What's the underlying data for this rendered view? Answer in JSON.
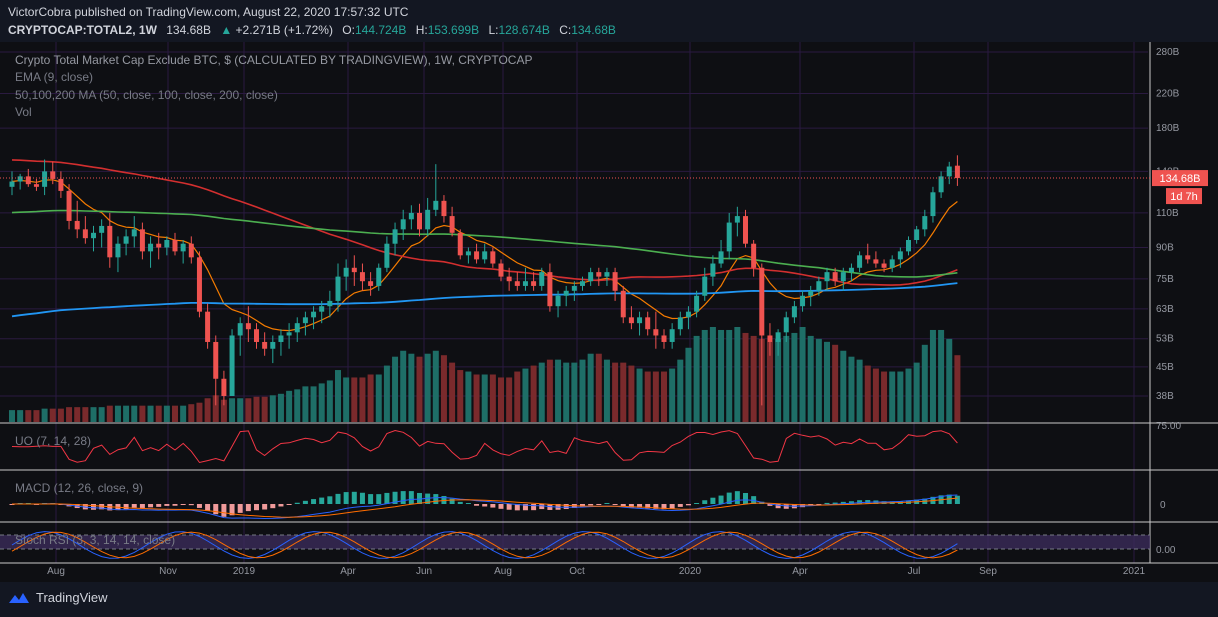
{
  "header": {
    "publisher": "VictorCobra published on TradingView.com, August 22, 2020 17:57:32 UTC",
    "symbol": "CRYPTOCAP:TOTAL2, 1W",
    "last": "134.68B",
    "change": "+2.271B (+1.72%)",
    "o_label": "O:",
    "o_value": "144.724B",
    "h_label": "H:",
    "h_value": "153.699B",
    "l_label": "L:",
    "l_value": "128.674B",
    "c_label": "C:",
    "c_value": "134.68B"
  },
  "legend": {
    "main": "Crypto Total Market Cap Exclude BTC, $ (CALCULATED BY TRADINGVIEW), 1W, CRYPTOCAP",
    "ema": "EMA (9, close)",
    "ma": "50,100,200 MA (50, close, 100, close, 200, close)",
    "vol": "Vol",
    "uo": "UO (7, 14, 28)",
    "macd": "MACD (12, 26, close, 9)",
    "stoch": "Stoch RSI (3, 3, 14, 14, close)"
  },
  "price_badge": "134.68B",
  "time_badge": "1d 7h",
  "footer": {
    "brand": "TradingView"
  },
  "colors": {
    "background": "#0e0f13",
    "bull": "#26a69a",
    "bear": "#ef5350",
    "ema": "#f57c00",
    "ma50": "#d32f2f",
    "ma100": "#4caf50",
    "ma200": "#2196f3",
    "grid": "#2a1a40",
    "stoch_band": "#3b2a5a"
  },
  "chart_data": {
    "type": "candlestick",
    "scale": "log",
    "y_ticks": [
      "280B",
      "220B",
      "180B",
      "140B",
      "110B",
      "90B",
      "75B",
      "63B",
      "53B",
      "45B",
      "38B"
    ],
    "y_tick_values": [
      280,
      220,
      180,
      140,
      110,
      90,
      75,
      63,
      53,
      45,
      38
    ],
    "x_ticks": [
      "Aug",
      "Nov",
      "2019",
      "Apr",
      "Jun",
      "Aug",
      "Oct",
      "2020",
      "Apr",
      "Jul",
      "Sep",
      "2021"
    ],
    "last_close": 134.68,
    "ohlc": [
      [
        128,
        140,
        122,
        132
      ],
      [
        132,
        138,
        126,
        136
      ],
      [
        136,
        142,
        128,
        130
      ],
      [
        130,
        134,
        125,
        128
      ],
      [
        128,
        150,
        122,
        140
      ],
      [
        140,
        148,
        130,
        134
      ],
      [
        134,
        140,
        120,
        125
      ],
      [
        125,
        130,
        100,
        105
      ],
      [
        105,
        118,
        95,
        100
      ],
      [
        100,
        108,
        92,
        95
      ],
      [
        95,
        102,
        88,
        98
      ],
      [
        98,
        106,
        90,
        102
      ],
      [
        102,
        110,
        80,
        85
      ],
      [
        85,
        96,
        78,
        92
      ],
      [
        92,
        100,
        86,
        96
      ],
      [
        96,
        108,
        90,
        100
      ],
      [
        100,
        104,
        84,
        88
      ],
      [
        88,
        96,
        80,
        92
      ],
      [
        92,
        98,
        84,
        90
      ],
      [
        90,
        96,
        86,
        94
      ],
      [
        94,
        98,
        86,
        88
      ],
      [
        88,
        94,
        82,
        92
      ],
      [
        92,
        96,
        82,
        85
      ],
      [
        85,
        88,
        60,
        62
      ],
      [
        62,
        65,
        50,
        52
      ],
      [
        52,
        54,
        36,
        42
      ],
      [
        42,
        44,
        36,
        38
      ],
      [
        38,
        56,
        38,
        54
      ],
      [
        54,
        60,
        48,
        58
      ],
      [
        58,
        64,
        52,
        56
      ],
      [
        56,
        58,
        50,
        52
      ],
      [
        52,
        55,
        48,
        50
      ],
      [
        50,
        54,
        46,
        52
      ],
      [
        52,
        56,
        48,
        54
      ],
      [
        54,
        58,
        50,
        55
      ],
      [
        55,
        60,
        52,
        58
      ],
      [
        58,
        62,
        54,
        60
      ],
      [
        60,
        64,
        56,
        62
      ],
      [
        62,
        66,
        58,
        64
      ],
      [
        64,
        70,
        60,
        66
      ],
      [
        66,
        82,
        62,
        76
      ],
      [
        76,
        84,
        70,
        80
      ],
      [
        80,
        86,
        72,
        78
      ],
      [
        78,
        82,
        70,
        74
      ],
      [
        74,
        78,
        68,
        72
      ],
      [
        72,
        82,
        70,
        80
      ],
      [
        80,
        96,
        78,
        92
      ],
      [
        92,
        104,
        86,
        100
      ],
      [
        100,
        112,
        94,
        106
      ],
      [
        106,
        115,
        100,
        110
      ],
      [
        110,
        116,
        96,
        100
      ],
      [
        100,
        120,
        96,
        112
      ],
      [
        112,
        146,
        108,
        118
      ],
      [
        118,
        122,
        104,
        108
      ],
      [
        108,
        114,
        96,
        98
      ],
      [
        98,
        100,
        84,
        86
      ],
      [
        86,
        90,
        82,
        88
      ],
      [
        88,
        92,
        82,
        84
      ],
      [
        84,
        92,
        82,
        88
      ],
      [
        88,
        90,
        80,
        82
      ],
      [
        82,
        84,
        74,
        76
      ],
      [
        76,
        80,
        70,
        74
      ],
      [
        74,
        78,
        70,
        72
      ],
      [
        72,
        80,
        70,
        74
      ],
      [
        74,
        78,
        70,
        72
      ],
      [
        72,
        80,
        70,
        78
      ],
      [
        78,
        82,
        62,
        64
      ],
      [
        64,
        70,
        60,
        68
      ],
      [
        68,
        72,
        64,
        70
      ],
      [
        70,
        74,
        66,
        72
      ],
      [
        72,
        76,
        70,
        74
      ],
      [
        74,
        80,
        72,
        78
      ],
      [
        78,
        80,
        72,
        76
      ],
      [
        76,
        80,
        72,
        78
      ],
      [
        78,
        80,
        66,
        70
      ],
      [
        70,
        72,
        58,
        60
      ],
      [
        60,
        64,
        56,
        58
      ],
      [
        58,
        62,
        54,
        60
      ],
      [
        60,
        62,
        54,
        56
      ],
      [
        56,
        62,
        50,
        54
      ],
      [
        54,
        56,
        50,
        52
      ],
      [
        52,
        58,
        50,
        56
      ],
      [
        56,
        62,
        54,
        60
      ],
      [
        60,
        64,
        56,
        62
      ],
      [
        62,
        70,
        60,
        68
      ],
      [
        68,
        80,
        66,
        76
      ],
      [
        76,
        86,
        72,
        82
      ],
      [
        82,
        94,
        80,
        88
      ],
      [
        88,
        110,
        84,
        104
      ],
      [
        104,
        114,
        96,
        108
      ],
      [
        108,
        112,
        90,
        92
      ],
      [
        92,
        94,
        76,
        80
      ],
      [
        80,
        82,
        36,
        54
      ],
      [
        54,
        58,
        48,
        52
      ],
      [
        52,
        56,
        48,
        55
      ],
      [
        55,
        62,
        52,
        60
      ],
      [
        60,
        66,
        58,
        64
      ],
      [
        64,
        70,
        62,
        68
      ],
      [
        68,
        72,
        64,
        70
      ],
      [
        70,
        76,
        68,
        74
      ],
      [
        74,
        80,
        70,
        78
      ],
      [
        78,
        80,
        72,
        74
      ],
      [
        74,
        80,
        70,
        78
      ],
      [
        78,
        82,
        74,
        80
      ],
      [
        80,
        88,
        78,
        86
      ],
      [
        86,
        92,
        82,
        84
      ],
      [
        84,
        88,
        80,
        82
      ],
      [
        82,
        84,
        78,
        80
      ],
      [
        80,
        86,
        78,
        84
      ],
      [
        84,
        90,
        80,
        88
      ],
      [
        88,
        96,
        86,
        94
      ],
      [
        94,
        102,
        92,
        100
      ],
      [
        100,
        112,
        96,
        108
      ],
      [
        108,
        128,
        104,
        124
      ],
      [
        124,
        140,
        120,
        136
      ],
      [
        136,
        148,
        130,
        144
      ],
      [
        144.724,
        153.699,
        128.674,
        134.68
      ]
    ],
    "volume": [
      8,
      8,
      8,
      8,
      9,
      9,
      9,
      10,
      10,
      10,
      10,
      10,
      11,
      11,
      11,
      11,
      11,
      11,
      11,
      11,
      11,
      11,
      12,
      13,
      16,
      18,
      15,
      16,
      16,
      16,
      17,
      17,
      18,
      19,
      21,
      22,
      24,
      24,
      26,
      28,
      35,
      30,
      30,
      30,
      32,
      32,
      38,
      44,
      48,
      46,
      44,
      46,
      48,
      45,
      40,
      35,
      34,
      32,
      32,
      32,
      30,
      30,
      34,
      36,
      38,
      40,
      42,
      42,
      40,
      40,
      42,
      46,
      46,
      42,
      40,
      40,
      38,
      36,
      34,
      34,
      34,
      36,
      42,
      50,
      58,
      62,
      64,
      62,
      62,
      64,
      60,
      58,
      56,
      54,
      56,
      58,
      60,
      64,
      58,
      56,
      54,
      52,
      48,
      44,
      42,
      38,
      36,
      34,
      34,
      34,
      36,
      40,
      52,
      62,
      62,
      56,
      45
    ],
    "series": [
      {
        "name": "EMA (9, close)"
      },
      {
        "name": "MA 50"
      },
      {
        "name": "MA 100"
      },
      {
        "name": "MA 200"
      }
    ]
  }
}
